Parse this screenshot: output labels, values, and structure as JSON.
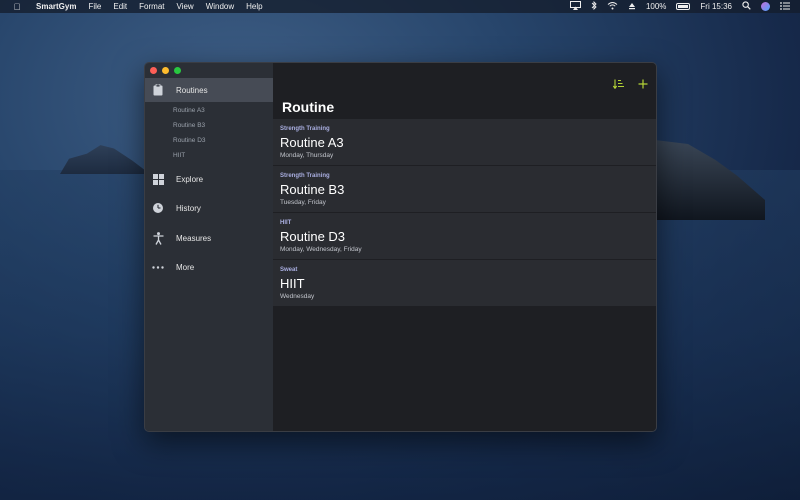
{
  "menubar": {
    "app_name": "SmartGym",
    "menus": [
      "File",
      "Edit",
      "Format",
      "View",
      "Window",
      "Help"
    ],
    "battery_text": "100%",
    "clock": "Fri 15:36"
  },
  "sidebar": {
    "items": [
      {
        "label": "Routines",
        "icon": "clipboard-icon"
      },
      {
        "label": "Explore",
        "icon": "grid-icon"
      },
      {
        "label": "History",
        "icon": "clock-icon"
      },
      {
        "label": "Measures",
        "icon": "person-icon"
      },
      {
        "label": "More",
        "icon": "ellipsis-icon"
      }
    ],
    "sub_items": [
      "Routine A3",
      "Routine B3",
      "Routine D3",
      "HIIT"
    ]
  },
  "main": {
    "title": "Routine",
    "routines": [
      {
        "category": "Strength Training",
        "name": "Routine A3",
        "days": "Monday, Thursday"
      },
      {
        "category": "Strength Training",
        "name": "Routine B3",
        "days": "Tuesday, Friday"
      },
      {
        "category": "HIIT",
        "name": "Routine D3",
        "days": "Monday, Wednesday, Friday"
      },
      {
        "category": "Sweat",
        "name": "HIIT",
        "days": "Wednesday"
      }
    ]
  },
  "colors": {
    "accent": "#b4d337",
    "category_text": "#a9aee0"
  }
}
